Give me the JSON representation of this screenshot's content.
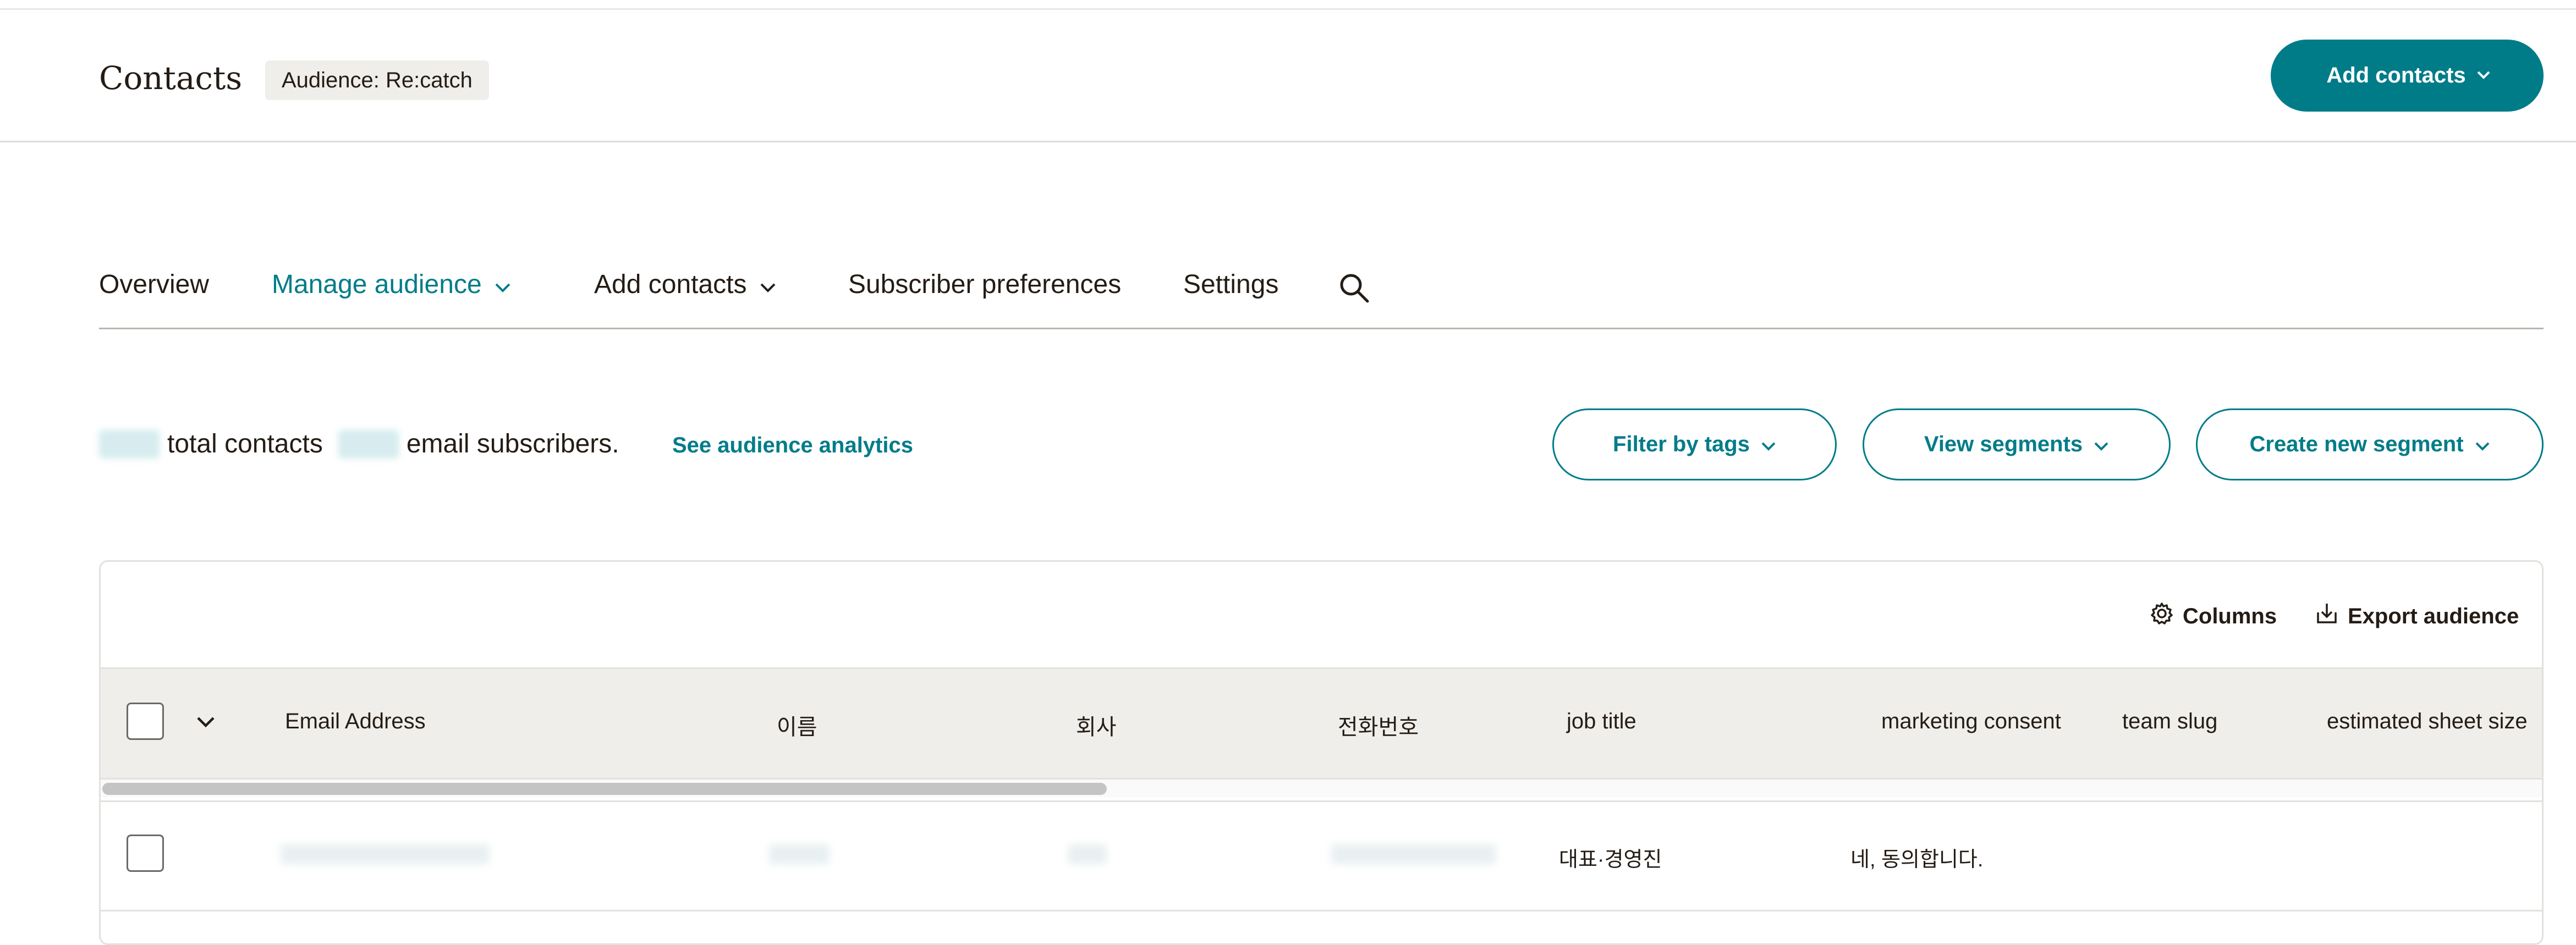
{
  "header": {
    "title": "Contacts",
    "audience_badge": "Audience: Re:catch",
    "add_contacts_label": "Add contacts"
  },
  "nav": {
    "overview": "Overview",
    "manage_audience": "Manage audience",
    "add_contacts": "Add contacts",
    "subscriber_preferences": "Subscriber preferences",
    "settings": "Settings"
  },
  "summary": {
    "total_contacts_text": "total contacts",
    "email_subscribers_text": "email subscribers.",
    "analytics_link": "See audience analytics"
  },
  "actions": {
    "filter_by_tags": "Filter by tags",
    "view_segments": "View segments",
    "create_new_segment": "Create new segment"
  },
  "table": {
    "columns_label": "Columns",
    "export_label": "Export audience",
    "headers": [
      "Email Address",
      "이름",
      "회사",
      "전화번호",
      "job title",
      "marketing consent",
      "team slug",
      "estimated sheet size"
    ],
    "rows": [
      {
        "job_title": "대표·경영진",
        "marketing_consent": "네, 동의합니다."
      }
    ]
  },
  "colors": {
    "accent": "#007c89",
    "text": "#241c15",
    "header_bg": "#efeeea"
  },
  "icons": [
    "chevron-down-icon",
    "search-icon",
    "gear-icon",
    "export-icon"
  ]
}
